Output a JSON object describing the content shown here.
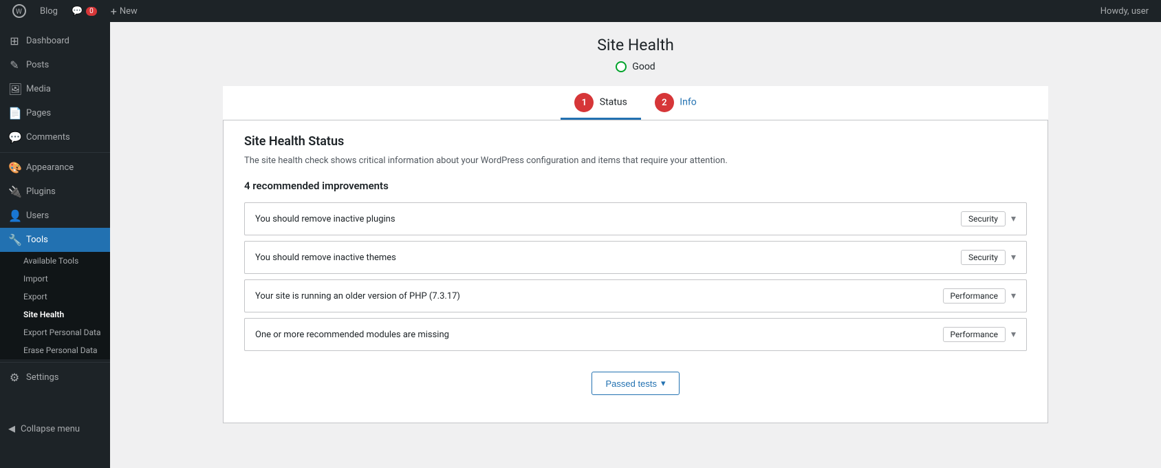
{
  "adminbar": {
    "wplogo_label": "WordPress",
    "blog_label": "Blog",
    "comments_count": "0",
    "new_label": "New",
    "howdy": "Howdy, user"
  },
  "sidebar": {
    "menu_items": [
      {
        "id": "dashboard",
        "label": "Dashboard",
        "icon": "⊞"
      },
      {
        "id": "posts",
        "label": "Posts",
        "icon": "✎"
      },
      {
        "id": "media",
        "label": "Media",
        "icon": "🖼"
      },
      {
        "id": "pages",
        "label": "Pages",
        "icon": "📄"
      },
      {
        "id": "comments",
        "label": "Comments",
        "icon": "💬"
      },
      {
        "id": "appearance",
        "label": "Appearance",
        "icon": "🎨"
      },
      {
        "id": "plugins",
        "label": "Plugins",
        "icon": "🔌"
      },
      {
        "id": "users",
        "label": "Users",
        "icon": "👤"
      },
      {
        "id": "tools",
        "label": "Tools",
        "icon": "🔧"
      },
      {
        "id": "settings",
        "label": "Settings",
        "icon": "⚙"
      }
    ],
    "tools_submenu": [
      {
        "id": "available-tools",
        "label": "Available Tools"
      },
      {
        "id": "import",
        "label": "Import"
      },
      {
        "id": "export",
        "label": "Export"
      },
      {
        "id": "site-health",
        "label": "Site Health",
        "active": true
      },
      {
        "id": "export-personal-data",
        "label": "Export Personal Data"
      },
      {
        "id": "erase-personal-data",
        "label": "Erase Personal Data"
      }
    ],
    "collapse_label": "Collapse menu"
  },
  "page": {
    "title": "Site Health",
    "health_status": "Good",
    "tabs": [
      {
        "id": "status",
        "label": "Status",
        "number": "1"
      },
      {
        "id": "info",
        "label": "Info",
        "number": "2"
      }
    ],
    "section_title": "Site Health Status",
    "section_description": "The site health check shows critical information about your WordPress configuration and items that require your attention.",
    "improvements_title": "4 recommended improvements",
    "issues": [
      {
        "id": "inactive-plugins",
        "title": "You should remove inactive plugins",
        "badge": "Security",
        "badge_type": "security"
      },
      {
        "id": "inactive-themes",
        "title": "You should remove inactive themes",
        "badge": "Security",
        "badge_type": "security"
      },
      {
        "id": "php-version",
        "title": "Your site is running an older version of PHP (7.3.17)",
        "badge": "Performance",
        "badge_type": "performance"
      },
      {
        "id": "missing-modules",
        "title": "One or more recommended modules are missing",
        "badge": "Performance",
        "badge_type": "performance"
      }
    ],
    "passed_tests_label": "Passed tests"
  }
}
